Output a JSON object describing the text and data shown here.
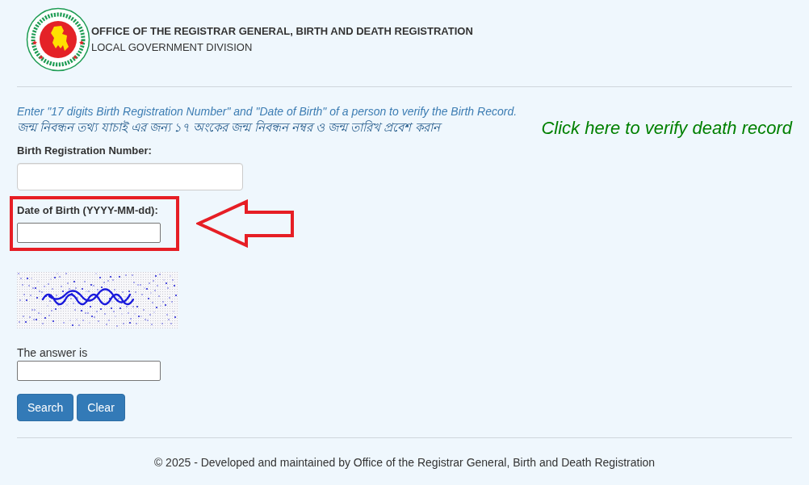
{
  "header": {
    "title": "OFFICE OF THE REGISTRAR GENERAL, BIRTH AND DEATH REGISTRATION",
    "subtitle": "LOCAL GOVERNMENT DIVISION"
  },
  "instructions": {
    "english": "Enter \"17 digits Birth Registration Number\" and \"Date of Birth\" of a person to verify the Birth Record.",
    "bangla": "জন্ম নিবন্ধন তথ্য যাচাই এর জন্য ১৭ অংকের জন্ম নিবন্ধন নম্বর ও জন্ম তারিখ প্রবেশ করান"
  },
  "death_record_link": "Click here to verify death record",
  "form": {
    "fields": [
      {
        "kind": "large",
        "label": "Birth Registration Number:",
        "highlighted": false
      },
      {
        "kind": "small",
        "label": "Date of Birth (YYYY-MM-dd):",
        "highlighted": true
      }
    ],
    "captcha": {
      "label": "The answer is"
    },
    "buttons": [
      {
        "label": "Search"
      },
      {
        "label": "Clear"
      }
    ]
  },
  "footer": "© 2025 - Developed and maintained by Office of the Registrar General, Birth and Death Registration"
}
